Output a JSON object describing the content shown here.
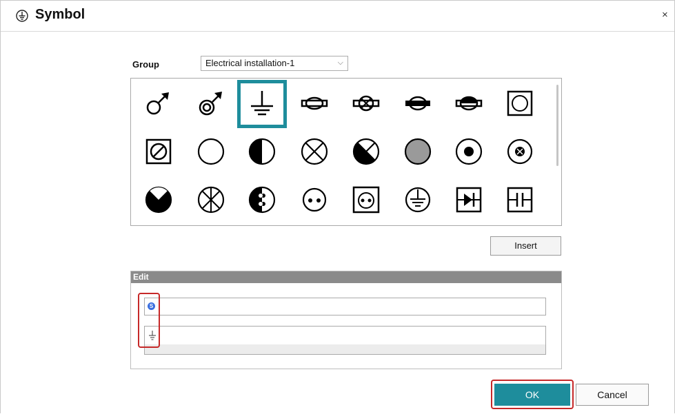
{
  "dialog": {
    "title": "Symbol",
    "title_icon": "earth-ground-circle-icon",
    "close_label": "×"
  },
  "group": {
    "label": "Group",
    "selected": "Electrical installation-1"
  },
  "palette": {
    "selected_index": 2,
    "symbols": [
      "male-arrow-symbol",
      "double-circle-arrow-symbol",
      "earth-ground-symbol",
      "lamp-bar-symbol",
      "lamp-cross-bar-symbol",
      "lamp-filled-bar-symbol",
      "lamp-half-bar-symbol",
      "square-circle-symbol",
      "square-slash-circle-symbol",
      "empty-circle-symbol",
      "half-filled-circle-symbol",
      "x-circle-symbol",
      "x-circle-filled-left-symbol",
      "gray-filled-circle-symbol",
      "dot-circle-symbol",
      "x-dot-circle-symbol",
      "bowtie-filled-circle-symbol",
      "asterisk-circle-symbol",
      "half-two-dots-circle-symbol",
      "two-dots-circle-symbol",
      "square-two-dots-circle-symbol",
      "ground-circle-symbol",
      "diode-box-symbol",
      "capacitor-box-symbol"
    ]
  },
  "insert_label": "Insert",
  "edit": {
    "header": "Edit",
    "input1_badge": "S",
    "input2_symbol": "earth-ground-small-icon"
  },
  "buttons": {
    "ok": "OK",
    "cancel": "Cancel"
  },
  "colors": {
    "accent": "#1e8d9c",
    "highlight_red": "#c62828",
    "edit_header": "#8a8a8a"
  }
}
